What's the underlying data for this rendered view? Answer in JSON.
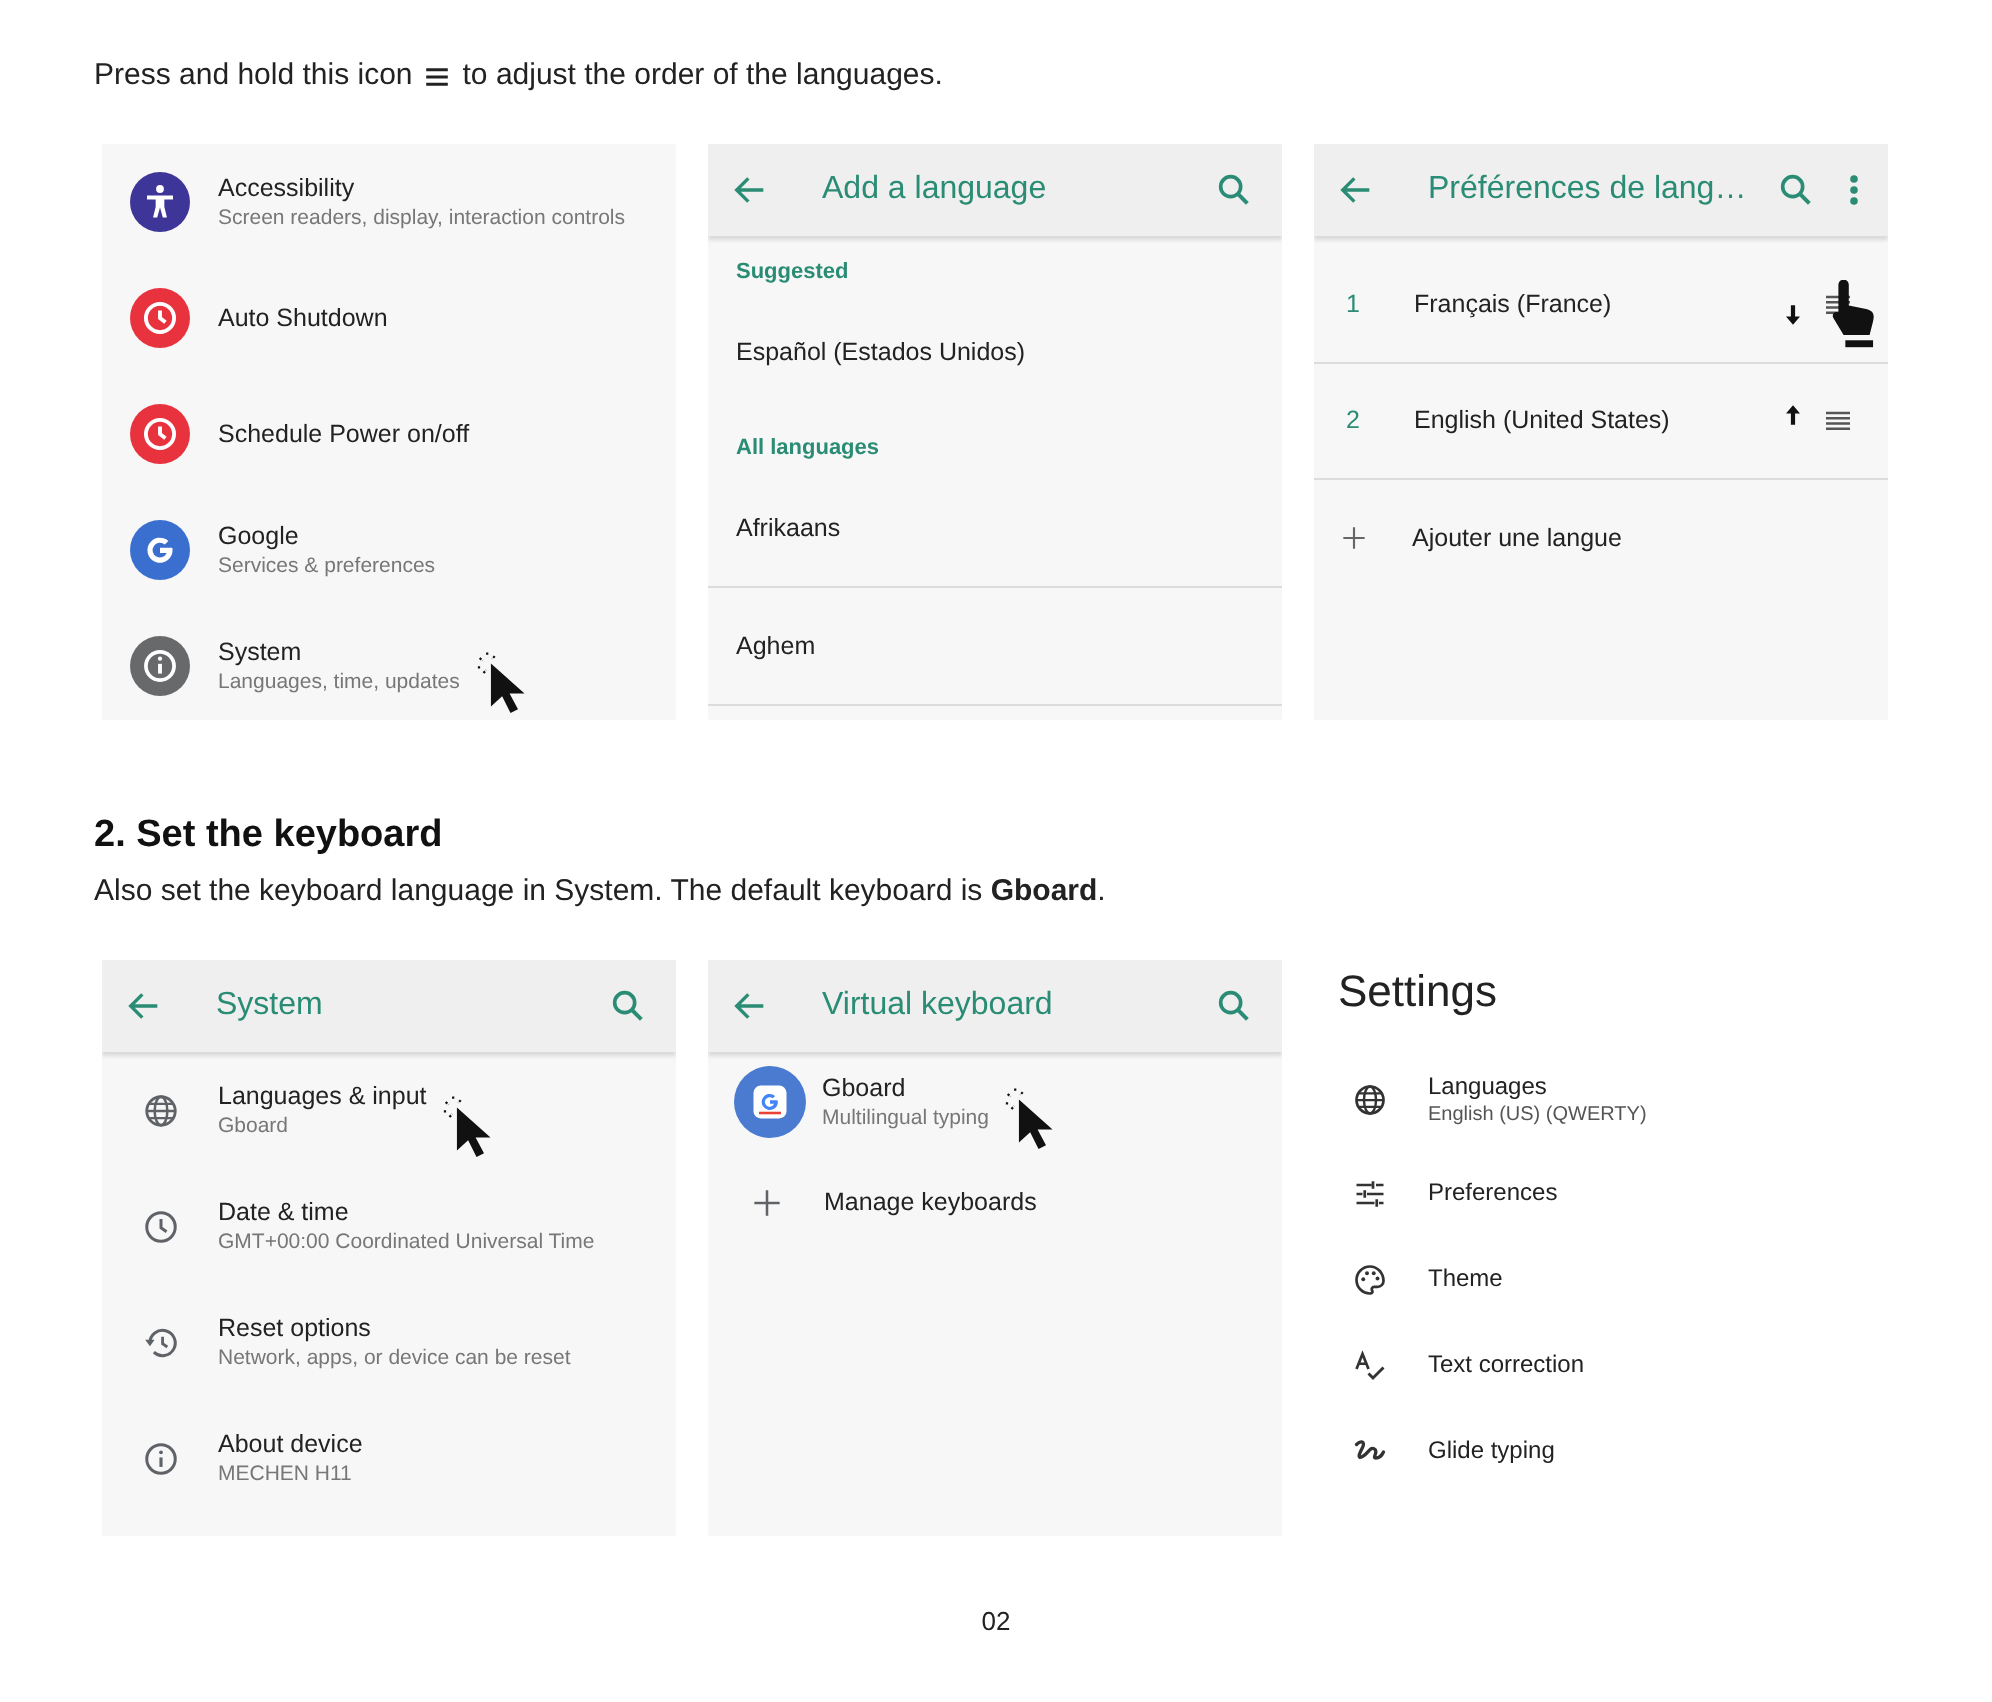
{
  "intro": {
    "text_before": "Press and hold this icon",
    "text_after": "to adjust the order of the languages."
  },
  "top_row": [
    {
      "kind": "menu",
      "items": [
        {
          "kind": "accessibility",
          "color": "#3d3597",
          "title": "Accessibility",
          "subtitle": "Screen readers, display, interaction controls",
          "cursor": false
        },
        {
          "kind": "clock",
          "color": "#e8333f",
          "title": "Auto Shutdown",
          "cursor": false
        },
        {
          "kind": "clock",
          "color": "#e8333f",
          "title": "Schedule Power on/off",
          "cursor": false
        },
        {
          "kind": "google",
          "color": "#3a6fd0",
          "title": "Google",
          "subtitle": "Services & preferences",
          "cursor": false
        },
        {
          "kind": "info",
          "color": "#68696b",
          "title": "System",
          "subtitle": "Languages, time, updates",
          "cursor": true
        }
      ]
    },
    {
      "kind": "add_language",
      "title": "Add a language",
      "sections": [
        {
          "header": "Suggested",
          "dividers": false,
          "items": [
            "Español (Estados Unidos)"
          ]
        },
        {
          "header": "All languages",
          "dividers": true,
          "items": [
            "Afrikaans",
            "Aghem"
          ]
        }
      ]
    },
    {
      "kind": "language_prefs",
      "title": "Préférences de lang…",
      "languages": [
        {
          "number": "1",
          "name": "Français (France)",
          "kind": "down",
          "dragging": true
        },
        {
          "number": "2",
          "name": "English (United States)",
          "kind": "up",
          "dragging": false
        }
      ],
      "add_label": "Ajouter une langue"
    }
  ],
  "section": {
    "heading": "2. Set the keyboard",
    "text": "Also set the keyboard language in System. The default keyboard is **Gboard**."
  },
  "bottom_row": [
    {
      "kind": "menu",
      "title": "System",
      "items": [
        {
          "kind": "globe",
          "title": "Languages & input",
          "subtitle": "Gboard",
          "cursor": true
        },
        {
          "kind": "clock",
          "title": "Date & time",
          "subtitle": "GMT+00:00 Coordinated Universal Time",
          "cursor": false
        },
        {
          "kind": "history",
          "title": "Reset options",
          "subtitle": "Network, apps, or device can be reset",
          "cursor": false
        },
        {
          "kind": "info",
          "title": "About device",
          "subtitle": "MECHEN H11",
          "cursor": false
        }
      ]
    },
    {
      "kind": "menu",
      "title": "Virtual keyboard",
      "items": [
        {
          "kind": "keyboard",
          "title": "Gboard",
          "subtitle": "Multilingual typing",
          "cursor": true
        },
        {
          "kind": "plus",
          "title": "Manage keyboards",
          "cursor": false
        }
      ]
    },
    {
      "kind": "keyboard_settings",
      "title": "Settings",
      "items": [
        {
          "kind": "globe",
          "title": "Languages",
          "subtitle": "English (US) (QWERTY)"
        },
        {
          "kind": "sliders",
          "title": "Preferences"
        },
        {
          "kind": "palette",
          "title": "Theme"
        },
        {
          "kind": "spellcheck",
          "title": "Text correction"
        },
        {
          "kind": "glide",
          "title": "Glide typing"
        }
      ]
    }
  ],
  "page_number": "02"
}
